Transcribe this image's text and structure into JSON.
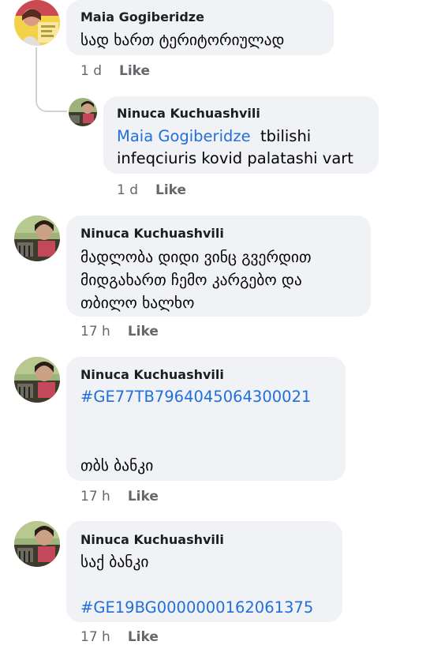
{
  "comments": [
    {
      "author": "Maia Gogiberidze",
      "text": "სად ხართ ტერიტორიულად",
      "time": "1 d",
      "like": "Like"
    },
    {
      "author": "Ninuca Kuchuashvili",
      "mention": "Maia Gogiberidze",
      "text_line1": "tbilishi",
      "text_line2": "infeqciuris kovid palatashi vart",
      "time": "1 d",
      "like": "Like"
    },
    {
      "author": "Ninuca Kuchuashvili",
      "lines": [
        "მადლობა დიდი ვინც გვერდით",
        "მიდგახართ ჩემო კარგებო და",
        "თბილო ხალხო"
      ],
      "time": "17 h",
      "like": "Like"
    },
    {
      "author": "Ninuca Kuchuashvili",
      "hashtag": "#GE77TB7964045064300021",
      "text": "თბს ბანკი",
      "time": "17 h",
      "like": "Like"
    },
    {
      "author": "Ninuca Kuchuashvili",
      "text": "საქ ბანკი",
      "hashtag": "#GE19BG0000000162061375",
      "time": "17 h",
      "like": "Like"
    }
  ],
  "colors": {
    "bubble": "#f0f2f5",
    "link": "#216fdb",
    "meta": "#65676b"
  }
}
